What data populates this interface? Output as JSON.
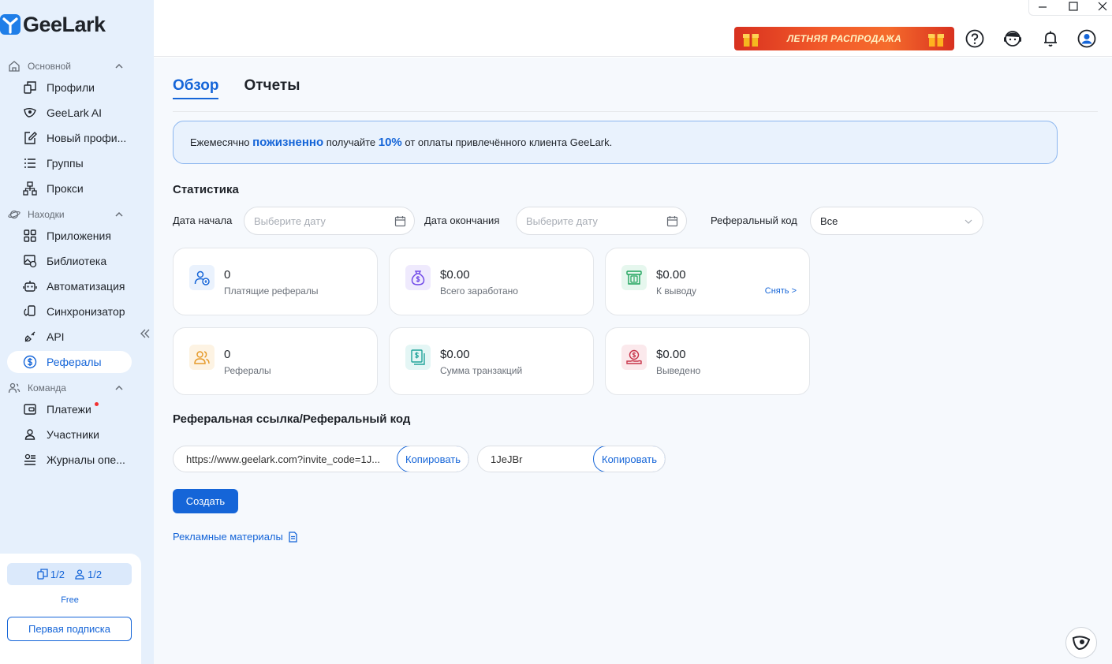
{
  "app": {
    "name": "GeeLark"
  },
  "sidebar": {
    "sections": [
      {
        "label": "Основной"
      },
      {
        "label": "Находки"
      },
      {
        "label": "Команда"
      }
    ],
    "items": [
      {
        "label": "Профили"
      },
      {
        "label": "GeeLark AI"
      },
      {
        "label": "Новый профи..."
      },
      {
        "label": "Группы"
      },
      {
        "label": "Прокси"
      },
      {
        "label": "Приложения"
      },
      {
        "label": "Библиотека"
      },
      {
        "label": "Автоматизация"
      },
      {
        "label": "Синхронизатор"
      },
      {
        "label": "API"
      },
      {
        "label": "Рефералы"
      },
      {
        "label": "Платежи"
      },
      {
        "label": "Участники"
      },
      {
        "label": "Журналы опе..."
      }
    ],
    "active_item": "Рефералы",
    "quota": {
      "profiles": "1/2",
      "members": "1/2"
    },
    "plan": "Free",
    "subscribe_label": "Первая подписка"
  },
  "header": {
    "sale_banner": "ЛЕТНЯЯ РАСПРОДАЖА",
    "icons": [
      "help-icon",
      "support-agent-icon",
      "bell-icon",
      "account-icon"
    ]
  },
  "tabs": [
    {
      "label": "Обзор",
      "active": true
    },
    {
      "label": "Отчеты",
      "active": false
    }
  ],
  "banner": {
    "part1": "Ежемесячно ",
    "highlight1": "пожизненно",
    "part2": " получайте ",
    "highlight2": "10%",
    "part3": " от оплаты привлечённого клиента GeeLark."
  },
  "stats": {
    "title": "Статистика",
    "filters": {
      "start_label": "Дата начала",
      "start_placeholder": "Выберите дату",
      "end_label": "Дата окончания",
      "end_placeholder": "Выберите дату",
      "code_label": "Реферальный код",
      "code_value": "Все"
    },
    "cards": [
      {
        "value": "0",
        "label": "Платящие рефералы"
      },
      {
        "value": "$0.00",
        "label": "Всего заработано"
      },
      {
        "value": "$0.00",
        "label": "К выводу",
        "action": "Снять >"
      },
      {
        "value": "0",
        "label": "Рефералы"
      },
      {
        "value": "$0.00",
        "label": "Сумма транзакций"
      },
      {
        "value": "$0.00",
        "label": "Выведено"
      }
    ]
  },
  "referral": {
    "title": "Реферальная ссылка/Реферальный код",
    "link": "https://www.geelark.com?invite_code=1J...",
    "code": "1JeJBr",
    "copy_label": "Копировать",
    "create_label": "Создать",
    "promo_label": "Рекламные материалы"
  },
  "colors": {
    "accent": "#1565d8",
    "sidebar_bg": "#e6f0fc",
    "main_bg": "#f6f9fd"
  }
}
